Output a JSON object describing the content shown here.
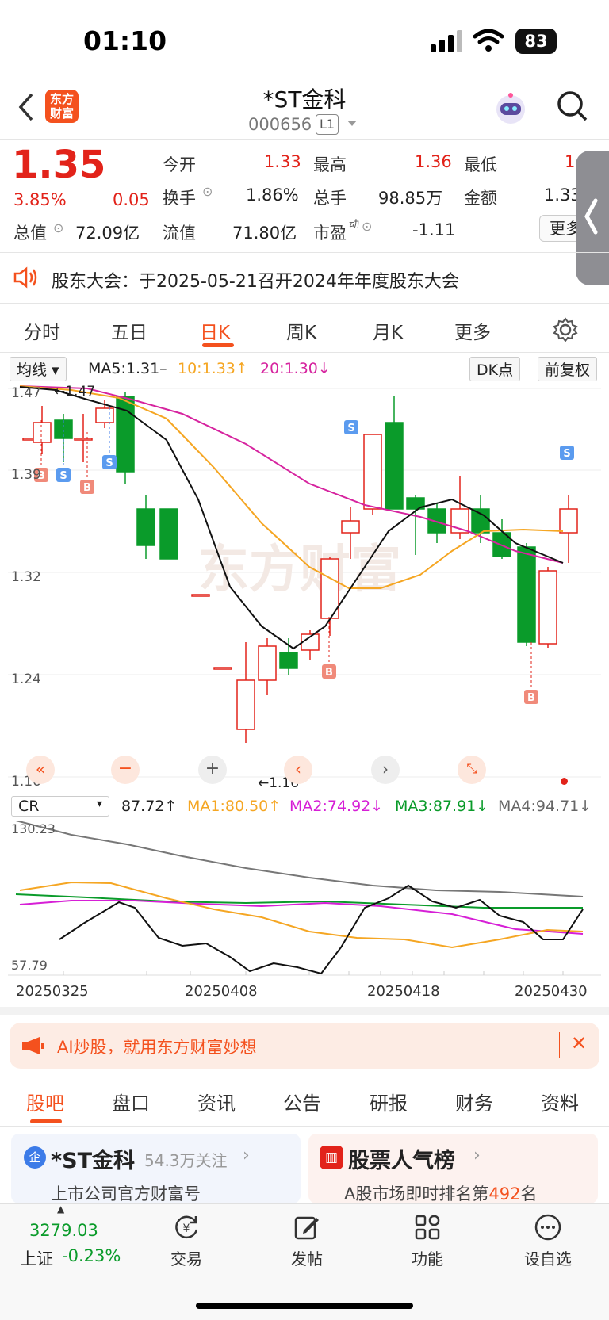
{
  "status": {
    "time": "01:10",
    "battery": "83"
  },
  "header": {
    "back": "‹",
    "logo_line1": "东方",
    "logo_line2": "财富",
    "title": "*ST金科",
    "code": "000656",
    "level": "L1"
  },
  "quote": {
    "price": "1.35",
    "change_pct": "3.85%",
    "change": "0.05",
    "total_value_label": "总值",
    "total_value": "72.09亿",
    "float_value_label": "流值",
    "float_value": "71.80亿",
    "pe_label": "市盈",
    "pe_sup": "动",
    "pe": "-1.11",
    "open_label": "今开",
    "open": "1.33",
    "high_label": "最高",
    "high": "1.36",
    "low_label": "最低",
    "low": "1.",
    "turnover_label": "换手",
    "turnover": "1.86%",
    "volume_label": "总手",
    "volume": "98.85万",
    "amount_label": "金额",
    "amount": "1.33",
    "more": "更多"
  },
  "notice": {
    "text": "股东大会：于2025-05-21召开2024年年度股东大会"
  },
  "period_tabs": [
    "分时",
    "五日",
    "日K",
    "周K",
    "月K",
    "更多"
  ],
  "kline": {
    "indicator": "均线",
    "ma5": "MA5:1.31–",
    "ma10": "10:1.33↑",
    "ma20": "20:1.30↓",
    "dk": "DK点",
    "adjust": "前复权",
    "y_ticks": [
      "1.47",
      "1.39",
      "1.32",
      "1.24",
      "1.16"
    ],
    "high_mark": "←1.47",
    "low_mark": "←1.16",
    "watermark": "东方财富"
  },
  "cr": {
    "indicator": "CR",
    "value": "87.72↑",
    "ma1": "MA1:80.50↑",
    "ma2": "MA2:74.92↓",
    "ma3": "MA3:87.91↓",
    "ma4": "MA4:94.71↓",
    "y_top": "130.23",
    "y_bottom": "57.79",
    "dates": [
      "20250325",
      "20250408",
      "20250418",
      "20250430"
    ]
  },
  "ad": {
    "text": "AI炒股，就用东方财富妙想"
  },
  "info_tabs": [
    "股吧",
    "盘口",
    "资讯",
    "公告",
    "研报",
    "财务",
    "资料"
  ],
  "cards": {
    "left_title": "*ST金科",
    "left_follow": "54.3万关注",
    "left_sub": "上市公司官方财富号",
    "right_title": "股票人气榜",
    "right_sub_pre": "A股市场即时排名第",
    "right_rank": "492",
    "right_sub_post": "名"
  },
  "bottom": {
    "index_value": "3279.03",
    "index_name": "上证",
    "index_change": "-0.23%",
    "trade": "交易",
    "post": "发帖",
    "func": "功能",
    "watch": "设自选"
  },
  "colors": {
    "up": "#e2231a",
    "down": "#0a9b2a",
    "accent": "#f4511e",
    "ma10": "#f5a623",
    "ma20": "#d6249f"
  }
}
